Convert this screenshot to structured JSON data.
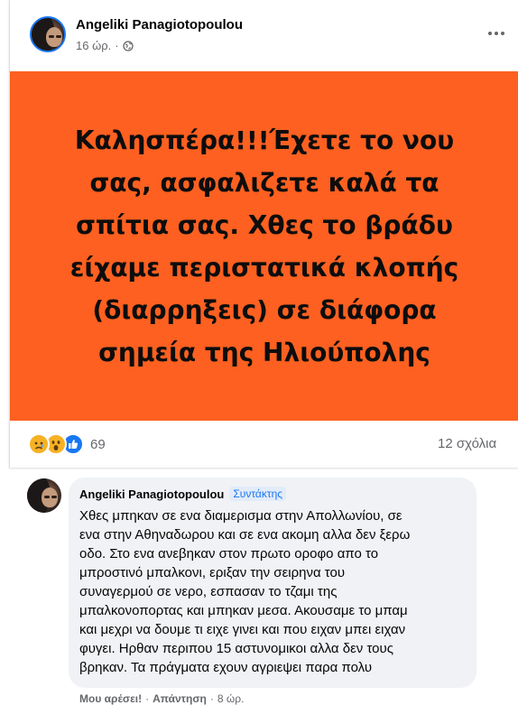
{
  "post": {
    "author": "Angeliki Panagiotopoulou",
    "time": "16 ώρ.",
    "separator": "·",
    "privacy_icon": "globe-icon",
    "more_icon": "more-horizontal-icon",
    "banner_color": "#fd6020",
    "text": "Καλησπέρα!!!Έχετε το νου\nσας, ασφαλιζετε καλά τα\nσπίτια σας. Χθες το βράδυ\nείχαμε περιστατικά κλοπής\n(διαρρηξεις) σε διάφορα\nσημεία της Ηλιούπολης"
  },
  "reactions": {
    "icons": [
      "sad-reaction-icon",
      "wow-reaction-icon",
      "like-reaction-icon"
    ],
    "count": "69",
    "comments": "12 σχόλια"
  },
  "comment": {
    "author": "Angeliki Panagiotopoulou",
    "badge": "Συντάκτης",
    "text": "Χθες μπηκαν σε ενα διαμερισμα στην Απολλωνίου, σε\nενα στην Αθηναδωρου και σε ενα ακομη αλλα δεν ξερω\nοδο. Στο ενα ανεβηκαν στον πρωτο οροφο απο το\nμπροστινό μπαλκονι, εριξαν την σειρηνα του\nσυναγερμού σε νερο, εσπασαν το τζαμι της\nμπαλκονοπορτας και μπηκαν μεσα. Ακουσαμε το μπαμ\nκαι μεχρι να δουμε τι ειχε γινει και που ειχαν μπει ειχαν\nφυγει. Ηρθαν περιπου 15 αστυνομικοι αλλα δεν τους\nβρηκαν. Τα πράγματα εχουν αγριεψει παρα πολυ",
    "like_label": "Μου αρέσει!",
    "reply_label": "Απάντηση",
    "time": "8 ώρ.",
    "separator": "·"
  }
}
